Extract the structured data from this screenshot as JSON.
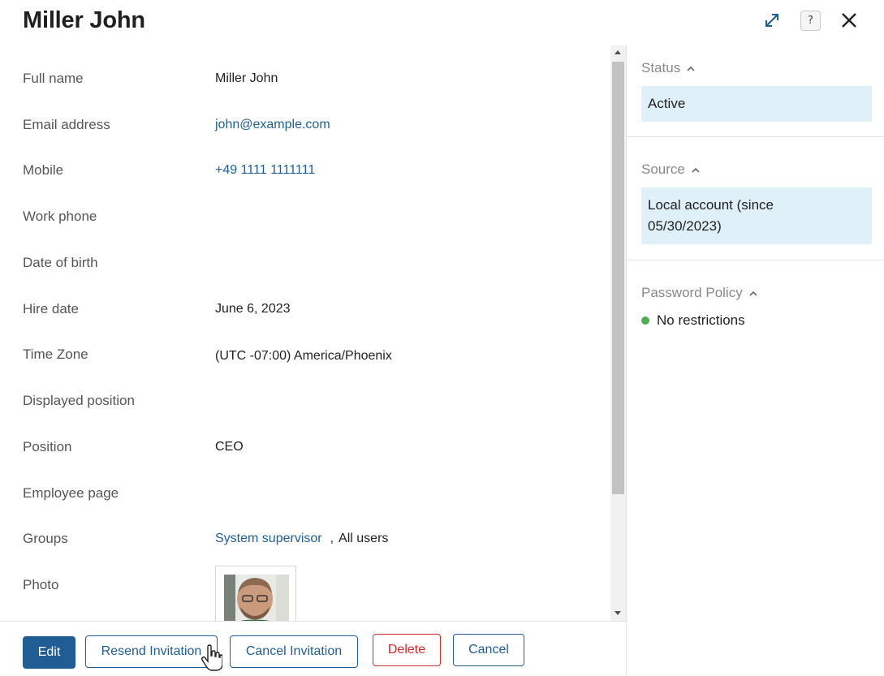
{
  "header": {
    "title": "Miller John",
    "icons": [
      "expand-icon",
      "help-icon",
      "close-icon"
    ],
    "help_glyph": "?"
  },
  "fields": [
    {
      "label": "Full name",
      "value": "Miller John",
      "link": false
    },
    {
      "label": "Email address",
      "value": "john@example.com",
      "link": true
    },
    {
      "label": "Mobile",
      "value": "+49 1111 1111111",
      "link": true
    },
    {
      "label": "Work phone",
      "value": "",
      "link": false
    },
    {
      "label": "Date of birth",
      "value": "",
      "link": false
    },
    {
      "label": "Hire date",
      "value": "June 6, 2023",
      "link": false
    },
    {
      "label": "Time Zone",
      "value": "(UTC -07:00) America/Phoenix",
      "link": false
    },
    {
      "label": "Displayed position",
      "value": "",
      "link": false
    },
    {
      "label": "Position",
      "value": "CEO",
      "link": false
    },
    {
      "label": "Employee page",
      "value": "",
      "link": false
    },
    {
      "label": "Groups",
      "value": "",
      "link": false
    },
    {
      "label": "Photo",
      "value": "",
      "link": false
    }
  ],
  "groups": {
    "first": "System supervisor",
    "separator": ",",
    "second": "All users"
  },
  "sidebar": {
    "status": {
      "heading": "Status",
      "value": "Active"
    },
    "source": {
      "heading": "Source",
      "value": "Local account (since 05/30/2023)"
    },
    "policy": {
      "heading": "Password Policy",
      "value": "No restrictions",
      "dot_color": "#4cae4f"
    }
  },
  "buttons": {
    "edit": "Edit",
    "resend": "Resend Invitation",
    "cancel_invitation": "Cancel Invitation",
    "delete": "Delete",
    "cancel": "Cancel"
  },
  "colors": {
    "primary": "#1f5d94",
    "link": "#1d5f99",
    "danger": "#d42a2a",
    "highlight_box": "#dff0f8"
  }
}
